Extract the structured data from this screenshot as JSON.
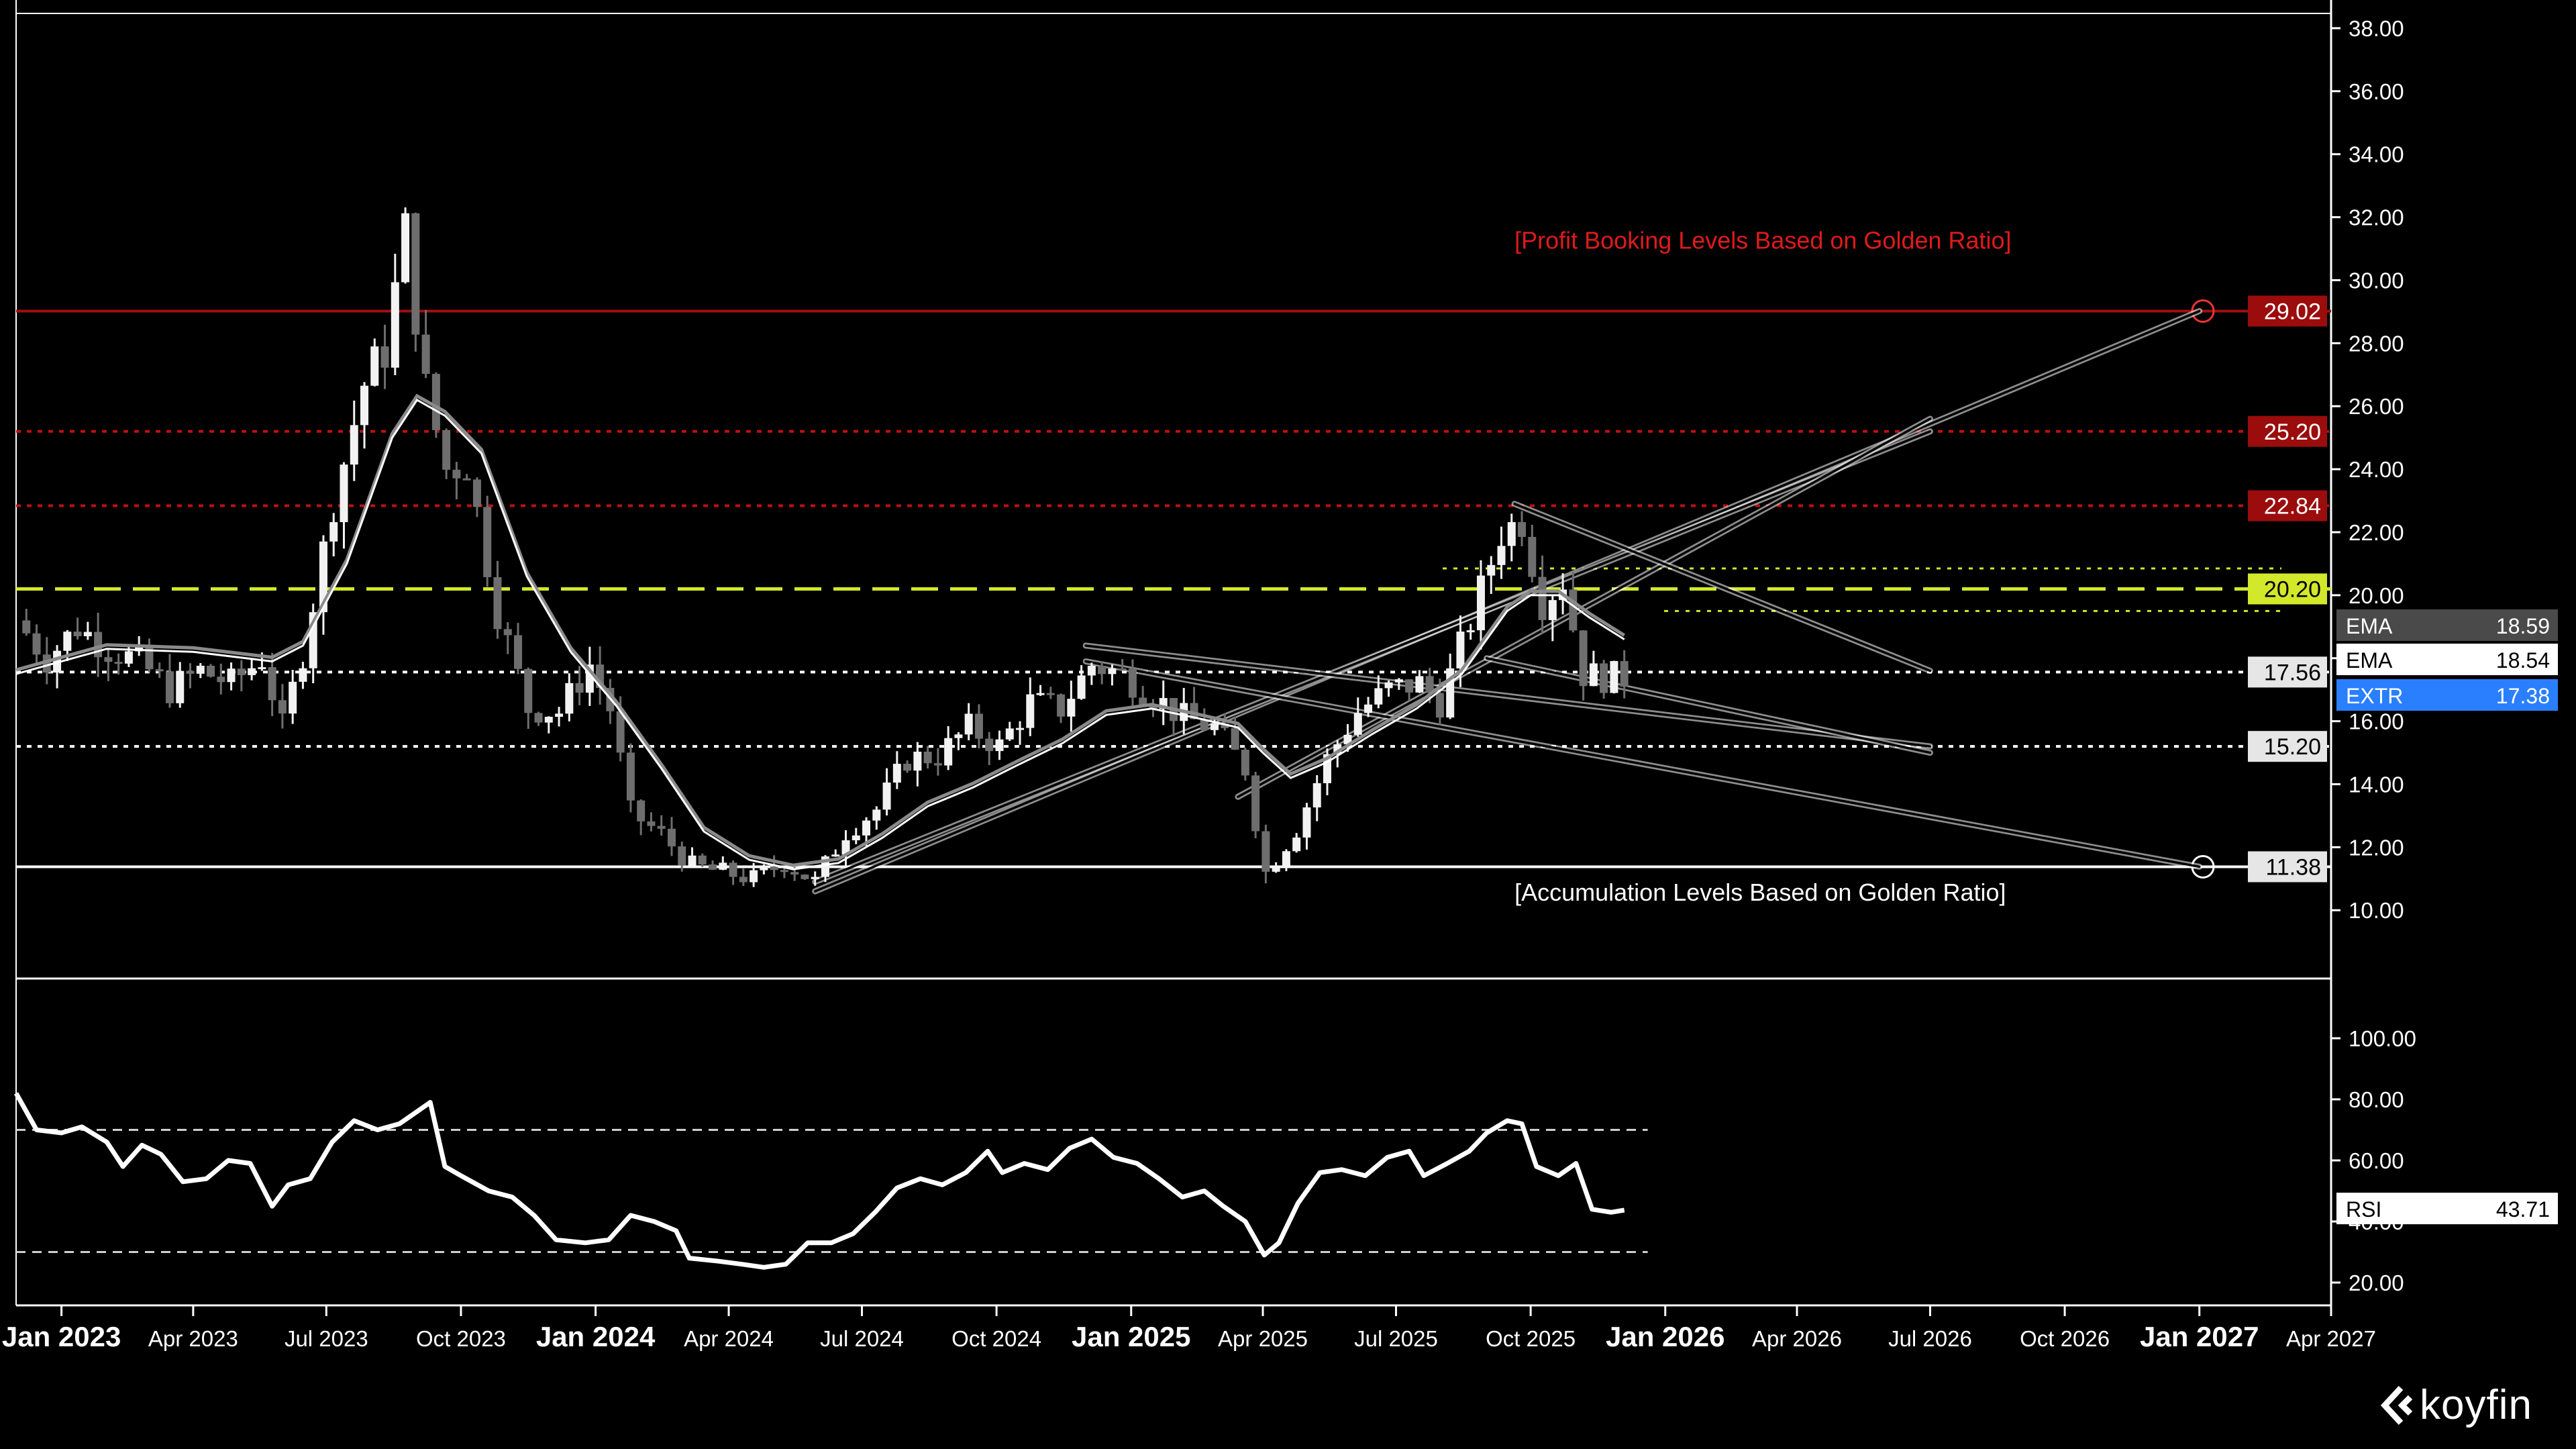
{
  "chart_data": [
    {
      "type": "candlestick",
      "panel": "price",
      "y_ticks": [
        "38.00",
        "36.00",
        "34.00",
        "32.00",
        "30.00",
        "28.00",
        "26.00",
        "24.00",
        "22.00",
        "20.00",
        "18.00",
        "16.00",
        "14.00",
        "12.00",
        "10.00"
      ],
      "ylim": [
        9,
        38.5
      ],
      "x_ticks": [
        "Jan 2023",
        "Apr 2023",
        "Jul 2023",
        "Oct 2023",
        "Jan 2024",
        "Apr 2024",
        "Jul 2024",
        "Oct 2024",
        "Jan 2025",
        "Apr 2025",
        "Jul 2025",
        "Oct 2025",
        "Jan 2026",
        "Apr 2026",
        "Jul 2026",
        "Oct 2026",
        "Jan 2027",
        "Apr 2027"
      ],
      "x_tick_bold": [
        true,
        false,
        false,
        false,
        true,
        false,
        false,
        false,
        true,
        false,
        false,
        false,
        true,
        false,
        false,
        false,
        true,
        false
      ],
      "xlim": [
        "2022-12-01",
        "2027-04-01"
      ],
      "close_series": [
        [
          "2022-12-01",
          19.2
        ],
        [
          "2022-12-22",
          18.0
        ],
        [
          "2023-01-12",
          19.0
        ],
        [
          "2023-02-02",
          18.3
        ],
        [
          "2023-02-23",
          17.9
        ],
        [
          "2023-03-16",
          17.0
        ],
        [
          "2023-04-06",
          17.6
        ],
        [
          "2023-04-27",
          17.2
        ],
        [
          "2023-05-18",
          18.0
        ],
        [
          "2023-06-01",
          15.8
        ],
        [
          "2023-06-15",
          18.2
        ],
        [
          "2023-07-06",
          23.0
        ],
        [
          "2023-07-27",
          26.7
        ],
        [
          "2023-08-10",
          27.8
        ],
        [
          "2023-08-24",
          31.5
        ],
        [
          "2023-09-07",
          26.5
        ],
        [
          "2023-09-21",
          24.0
        ],
        [
          "2023-10-05",
          24.2
        ],
        [
          "2023-10-26",
          19.5
        ],
        [
          "2023-11-16",
          16.4
        ],
        [
          "2023-12-07",
          16.3
        ],
        [
          "2023-12-28",
          17.8
        ],
        [
          "2024-01-11",
          16.4
        ],
        [
          "2024-01-25",
          13.1
        ],
        [
          "2024-02-15",
          12.4
        ],
        [
          "2024-03-07",
          11.4
        ],
        [
          "2024-03-28",
          11.2
        ],
        [
          "2024-04-18",
          11.0
        ],
        [
          "2024-05-09",
          11.5
        ],
        [
          "2024-05-30",
          10.9
        ],
        [
          "2024-06-20",
          12.5
        ],
        [
          "2024-07-11",
          13.2
        ],
        [
          "2024-08-01",
          14.8
        ],
        [
          "2024-08-22",
          14.9
        ],
        [
          "2024-09-12",
          15.8
        ],
        [
          "2024-10-03",
          15.2
        ],
        [
          "2024-10-24",
          16.6
        ],
        [
          "2024-11-14",
          16.4
        ],
        [
          "2024-12-05",
          17.8
        ],
        [
          "2024-12-26",
          17.5
        ],
        [
          "2025-01-16",
          16.8
        ],
        [
          "2025-02-06",
          16.1
        ],
        [
          "2025-02-27",
          15.8
        ],
        [
          "2025-03-20",
          14.5
        ],
        [
          "2025-04-03",
          11.2
        ],
        [
          "2025-04-24",
          12.6
        ],
        [
          "2025-05-15",
          14.8
        ],
        [
          "2025-06-05",
          16.3
        ],
        [
          "2025-06-26",
          17.0
        ],
        [
          "2025-07-17",
          17.2
        ],
        [
          "2025-07-31",
          16.6
        ],
        [
          "2025-08-21",
          19.2
        ],
        [
          "2025-09-11",
          22.0
        ],
        [
          "2025-09-25",
          22.4
        ],
        [
          "2025-10-09",
          19.8
        ],
        [
          "2025-10-23",
          20.5
        ],
        [
          "2025-11-06",
          17.5
        ],
        [
          "2025-11-20",
          17.4
        ],
        [
          "2025-12-04",
          17.38
        ]
      ],
      "ema_series": [
        [
          "2022-12-01",
          17.5
        ],
        [
          "2023-02-01",
          18.3
        ],
        [
          "2023-04-01",
          18.2
        ],
        [
          "2023-05-25",
          17.9
        ],
        [
          "2023-06-15",
          18.4
        ],
        [
          "2023-07-15",
          21.0
        ],
        [
          "2023-08-15",
          25.0
        ],
        [
          "2023-09-01",
          26.2
        ],
        [
          "2023-09-20",
          25.7
        ],
        [
          "2023-10-15",
          24.5
        ],
        [
          "2023-11-15",
          20.6
        ],
        [
          "2023-12-15",
          18.2
        ],
        [
          "2024-01-15",
          16.5
        ],
        [
          "2024-02-15",
          14.5
        ],
        [
          "2024-03-15",
          12.5
        ],
        [
          "2024-04-15",
          11.6
        ],
        [
          "2024-05-15",
          11.3
        ],
        [
          "2024-06-15",
          11.5
        ],
        [
          "2024-07-15",
          12.3
        ],
        [
          "2024-08-15",
          13.3
        ],
        [
          "2024-09-15",
          13.9
        ],
        [
          "2024-10-15",
          14.6
        ],
        [
          "2024-11-15",
          15.3
        ],
        [
          "2024-12-15",
          16.2
        ],
        [
          "2025-01-15",
          16.4
        ],
        [
          "2025-02-15",
          16.1
        ],
        [
          "2025-03-15",
          15.8
        ],
        [
          "2025-04-01",
          15.0
        ],
        [
          "2025-04-20",
          14.2
        ],
        [
          "2025-05-15",
          14.7
        ],
        [
          "2025-06-15",
          15.6
        ],
        [
          "2025-07-15",
          16.4
        ],
        [
          "2025-08-15",
          17.5
        ],
        [
          "2025-09-15",
          19.5
        ],
        [
          "2025-10-01",
          20.0
        ],
        [
          "2025-10-20",
          20.0
        ],
        [
          "2025-11-10",
          19.3
        ],
        [
          "2025-12-04",
          18.6
        ]
      ],
      "levels": [
        {
          "value": 29.02,
          "label": "29.02",
          "style": "solid",
          "color": "#a01010",
          "badge_bg": "#9b0c0c",
          "badge_fg": "#ffffff",
          "marker": "circle"
        },
        {
          "value": 25.2,
          "label": "25.20",
          "style": "dotted",
          "color": "#c01010",
          "badge_bg": "#9b0c0c",
          "badge_fg": "#ffffff"
        },
        {
          "value": 22.84,
          "label": "22.84",
          "style": "dotted",
          "color": "#c01010",
          "badge_bg": "#9b0c0c",
          "badge_fg": "#ffffff"
        },
        {
          "value": 20.2,
          "label": "20.20",
          "style": "dashed",
          "color": "#d2e82a",
          "badge_bg": "#d2e82a",
          "badge_fg": "#000000"
        },
        {
          "value": 17.56,
          "label": "17.56",
          "style": "dotted",
          "color": "#ffffff",
          "badge_bg": "#e6e6e6",
          "badge_fg": "#000000"
        },
        {
          "value": 15.2,
          "label": "15.20",
          "style": "dotted",
          "color": "#ffffff",
          "badge_bg": "#e6e6e6",
          "badge_fg": "#000000"
        },
        {
          "value": 11.38,
          "label": "11.38",
          "style": "solid",
          "color": "#ffffff",
          "badge_bg": "#e6e6e6",
          "badge_fg": "#000000",
          "marker": "circle"
        }
      ],
      "annotations": [
        {
          "text": "[Profit Booking Levels Based on Golden Ratio]",
          "color": "#e01a1a",
          "date": "2025-09-20",
          "value": 31.0
        },
        {
          "text": "[Accumulation Levels Based on Golden Ratio]",
          "color": "#ffffff",
          "date": "2025-09-20",
          "value": 10.3
        }
      ],
      "legend": [
        {
          "name": "EMA",
          "value": "18.59",
          "bg": "#4a4a4a",
          "fg": "#ffffff"
        },
        {
          "name": "EMA",
          "value": "18.54",
          "bg": "#ffffff",
          "fg": "#000000"
        },
        {
          "name": "EXTR",
          "value": "17.38",
          "bg": "#2a7fff",
          "fg": "#ffffff"
        }
      ]
    },
    {
      "type": "line",
      "panel": "rsi",
      "y_ticks": [
        "100.00",
        "80.00",
        "60.00",
        "40.00",
        "20.00"
      ],
      "ylim": [
        12,
        108
      ],
      "bands": [
        70,
        30
      ],
      "legend": {
        "name": "RSI",
        "value": "43.71"
      },
      "series": [
        [
          "2022-12-01",
          82
        ],
        [
          "2022-12-15",
          70
        ],
        [
          "2023-01-01",
          69
        ],
        [
          "2023-01-15",
          71
        ],
        [
          "2023-02-01",
          66
        ],
        [
          "2023-02-12",
          58
        ],
        [
          "2023-02-25",
          65
        ],
        [
          "2023-03-10",
          62
        ],
        [
          "2023-03-25",
          53
        ],
        [
          "2023-04-10",
          54
        ],
        [
          "2023-04-25",
          60
        ],
        [
          "2023-05-10",
          59
        ],
        [
          "2023-05-25",
          45
        ],
        [
          "2023-06-05",
          52
        ],
        [
          "2023-06-20",
          54
        ],
        [
          "2023-07-05",
          66
        ],
        [
          "2023-07-20",
          73
        ],
        [
          "2023-08-05",
          70
        ],
        [
          "2023-08-20",
          72
        ],
        [
          "2023-09-01",
          76
        ],
        [
          "2023-09-10",
          79
        ],
        [
          "2023-09-20",
          58
        ],
        [
          "2023-10-01",
          55
        ],
        [
          "2023-10-20",
          50
        ],
        [
          "2023-11-05",
          48
        ],
        [
          "2023-11-20",
          42
        ],
        [
          "2023-12-05",
          34
        ],
        [
          "2023-12-25",
          33
        ],
        [
          "2024-01-10",
          34
        ],
        [
          "2024-01-25",
          42
        ],
        [
          "2024-02-10",
          40
        ],
        [
          "2024-02-25",
          37
        ],
        [
          "2024-03-05",
          28
        ],
        [
          "2024-03-25",
          27
        ],
        [
          "2024-04-10",
          26
        ],
        [
          "2024-04-25",
          25
        ],
        [
          "2024-05-10",
          26
        ],
        [
          "2024-05-25",
          33
        ],
        [
          "2024-06-10",
          33
        ],
        [
          "2024-06-25",
          36
        ],
        [
          "2024-07-10",
          43
        ],
        [
          "2024-07-25",
          51
        ],
        [
          "2024-08-10",
          54
        ],
        [
          "2024-08-25",
          52
        ],
        [
          "2024-09-10",
          56
        ],
        [
          "2024-09-25",
          63
        ],
        [
          "2024-10-05",
          56
        ],
        [
          "2024-10-20",
          59
        ],
        [
          "2024-11-05",
          57
        ],
        [
          "2024-11-20",
          64
        ],
        [
          "2024-12-05",
          67
        ],
        [
          "2024-12-20",
          61
        ],
        [
          "2025-01-05",
          59
        ],
        [
          "2025-01-20",
          54
        ],
        [
          "2025-02-05",
          48
        ],
        [
          "2025-02-20",
          50
        ],
        [
          "2025-03-05",
          45
        ],
        [
          "2025-03-20",
          40
        ],
        [
          "2025-04-02",
          29
        ],
        [
          "2025-04-12",
          33
        ],
        [
          "2025-04-25",
          46
        ],
        [
          "2025-05-10",
          56
        ],
        [
          "2025-05-25",
          57
        ],
        [
          "2025-06-10",
          55
        ],
        [
          "2025-06-25",
          61
        ],
        [
          "2025-07-10",
          63
        ],
        [
          "2025-07-20",
          55
        ],
        [
          "2025-08-05",
          59
        ],
        [
          "2025-08-20",
          63
        ],
        [
          "2025-09-01",
          69
        ],
        [
          "2025-09-15",
          73
        ],
        [
          "2025-09-25",
          72
        ],
        [
          "2025-10-05",
          58
        ],
        [
          "2025-10-20",
          55
        ],
        [
          "2025-11-01",
          59
        ],
        [
          "2025-11-12",
          44
        ],
        [
          "2025-11-25",
          43
        ],
        [
          "2025-12-04",
          43.71
        ]
      ]
    }
  ],
  "colors": {
    "background": "#000000",
    "candle_up": "#f2f2f2",
    "candle_down": "#6e6e6e",
    "ema_slow": "#8a8a8a",
    "ema_fast": "#ffffff",
    "trend": "#a8a8a8",
    "axis_text": "#ffffff"
  },
  "brand": {
    "name": "koyfin",
    "icon": "koyfin-logo-icon"
  }
}
